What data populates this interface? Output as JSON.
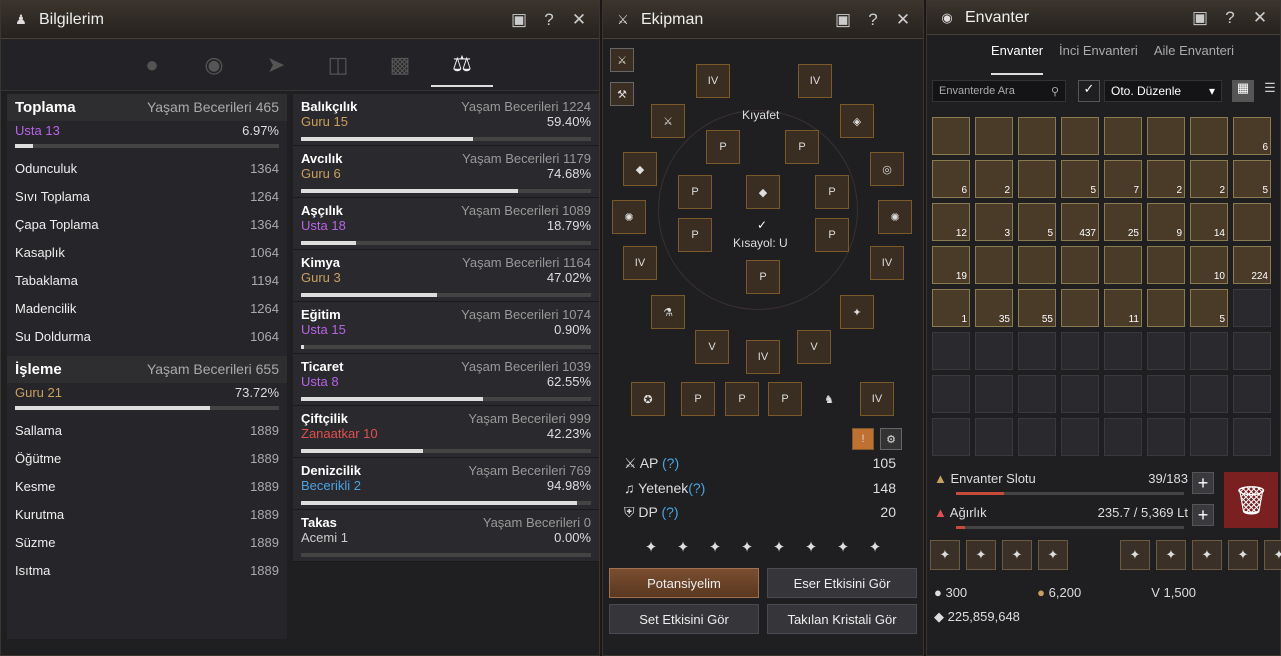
{
  "info": {
    "title": "Bilgilerim"
  },
  "gathering": {
    "name": "Toplama",
    "label": "Yaşam Becerileri 465",
    "rank": "Usta 13",
    "pct": "6.97%",
    "progress": 0.07,
    "skills": [
      {
        "n": "Odunculuk",
        "v": "1364"
      },
      {
        "n": "Sıvı Toplama",
        "v": "1264"
      },
      {
        "n": "Çapa Toplama",
        "v": "1364"
      },
      {
        "n": "Kasaplık",
        "v": "1064"
      },
      {
        "n": "Tabaklama",
        "v": "1194"
      },
      {
        "n": "Madencilik",
        "v": "1264"
      },
      {
        "n": "Su Doldurma",
        "v": "1064"
      }
    ]
  },
  "processing": {
    "name": "İşleme",
    "label": "Yaşam Becerileri 655",
    "rank": "Guru 21",
    "pct": "73.72%",
    "progress": 0.74,
    "skills": [
      {
        "n": "Sallama",
        "v": "1889"
      },
      {
        "n": "Öğütme",
        "v": "1889"
      },
      {
        "n": "Kesme",
        "v": "1889"
      },
      {
        "n": "Kurutma",
        "v": "1889"
      },
      {
        "n": "Süzme",
        "v": "1889"
      },
      {
        "n": "Isıtma",
        "v": "1889"
      }
    ]
  },
  "cards": [
    {
      "n": "Balıkçılık",
      "lv": "Yaşam Becerileri 1224",
      "rank": "Guru 15",
      "pct": "59.40%",
      "p": 0.594,
      "c": "gold"
    },
    {
      "n": "Avcılık",
      "lv": "Yaşam Becerileri 1179",
      "rank": "Guru 6",
      "pct": "74.68%",
      "p": 0.747,
      "c": "gold"
    },
    {
      "n": "Aşçılık",
      "lv": "Yaşam Becerileri 1089",
      "rank": "Usta 18",
      "pct": "18.79%",
      "p": 0.188,
      "c": "purple"
    },
    {
      "n": "Kimya",
      "lv": "Yaşam Becerileri 1164",
      "rank": "Guru 3",
      "pct": "47.02%",
      "p": 0.47,
      "c": "gold"
    },
    {
      "n": "Eğitim",
      "lv": "Yaşam Becerileri 1074",
      "rank": "Usta 15",
      "pct": "0.90%",
      "p": 0.009,
      "c": "purple"
    },
    {
      "n": "Ticaret",
      "lv": "Yaşam Becerileri 1039",
      "rank": "Usta 8",
      "pct": "62.55%",
      "p": 0.626,
      "c": "purple"
    },
    {
      "n": "Çiftçilik",
      "lv": "Yaşam Becerileri 999",
      "rank": "Zanaatkar 10",
      "pct": "42.23%",
      "p": 0.422,
      "c": "red"
    },
    {
      "n": "Denizcilik",
      "lv": "Yaşam Becerileri 769",
      "rank": "Becerikli 2",
      "pct": "94.98%",
      "p": 0.95,
      "c": "blue"
    },
    {
      "n": "Takas",
      "lv": "Yaşam Becerileri 0",
      "rank": "Acemi 1",
      "pct": "0.00%",
      "p": 0,
      "c": "gray"
    }
  ],
  "equip": {
    "title": "Ekipman",
    "costume": "Kıyafet",
    "shortcut": "Kısayol: U",
    "ap_label": "AP",
    "ap": "105",
    "talent_label": "Yetenek",
    "talent": "148",
    "dp_label": "DP",
    "dp": "20",
    "q": "(?)",
    "btn_potential": "Potansiyelim",
    "btn_artifact": "Eser Etkisini Gör",
    "btn_set": "Set Etkisini Gör",
    "btn_crystal": "Takılan Kristali Gör"
  },
  "inv": {
    "title": "Envanter",
    "tabs": [
      "Envanter",
      "İnci Envanteri",
      "Aile Envanteri"
    ],
    "search": "Envanterde Ara",
    "auto": "Oto. Düzenle",
    "slot_label": "Envanter Slotu",
    "slot": "39/183",
    "slot_fill": 0.21,
    "weight_label": "Ağırlık",
    "weight": "235.7 / 5,369 Lt",
    "weight_fill": 0.04,
    "pearl": "300",
    "silver_small": "6,200",
    "v": "1,500",
    "silver": "225,859,648",
    "counts": [
      "",
      "",
      "",
      "",
      "",
      "",
      "",
      "6",
      "6",
      "2",
      "",
      "5",
      "7",
      "2",
      "2",
      "5",
      "12",
      "3",
      "5",
      "437",
      "25",
      "9",
      "14",
      "",
      "19",
      "",
      "",
      "",
      "",
      "",
      "10",
      "224",
      "1",
      "35",
      "55",
      "",
      "11",
      "",
      "5",
      ""
    ]
  }
}
